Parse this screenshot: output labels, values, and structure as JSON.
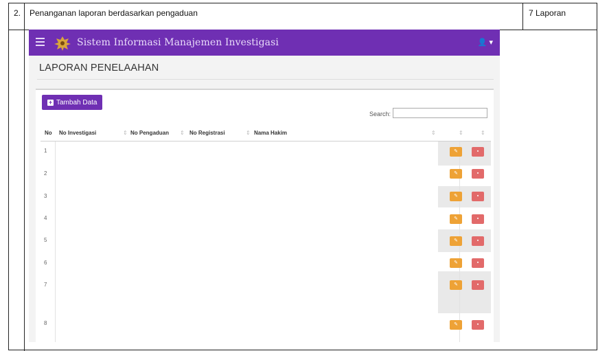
{
  "document": {
    "row_number": "2.",
    "row_description": "Penanganan laporan berdasarkan pengaduan",
    "row_count": "7 Laporan"
  },
  "app": {
    "title": "Sistem Informasi Manajemen Investigasi",
    "user_menu": "👤 ▾"
  },
  "page": {
    "title": "LAPORAN PENELAAHAN",
    "add_button_label": "Tambah Data",
    "search_label": "Search:",
    "search_value": ""
  },
  "table": {
    "headers": [
      "No",
      "No Investigasi",
      "No Pengaduan",
      "No Registrasi",
      "Nama Hakim"
    ],
    "rows": [
      "1",
      "2",
      "3",
      "4",
      "5",
      "6",
      "7",
      "8"
    ]
  },
  "colors": {
    "navbar": "#6f2fb3",
    "edit": "#eea236",
    "delete": "#e26a6a"
  },
  "icons": [
    "hamburger-icon",
    "emblem-icon",
    "user-icon",
    "plus-icon",
    "edit-icon",
    "trash-icon",
    "sort-icon"
  ]
}
